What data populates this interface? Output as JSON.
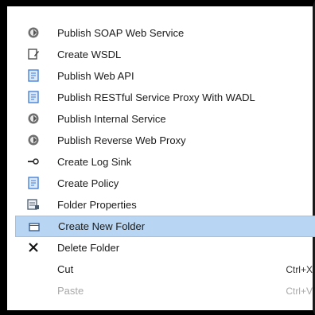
{
  "menu": {
    "items": [
      {
        "label": "Publish SOAP Web Service",
        "icon": "gear-icon"
      },
      {
        "label": "Create WSDL",
        "icon": "document-edit-icon"
      },
      {
        "label": "Publish Web API",
        "icon": "document-icon"
      },
      {
        "label": "Publish RESTful Service Proxy With WADL",
        "icon": "document-icon"
      },
      {
        "label": "Publish Internal Service",
        "icon": "gear-icon"
      },
      {
        "label": "Publish Reverse Web Proxy",
        "icon": "gear-icon"
      },
      {
        "label": "Create Log Sink",
        "icon": "key-icon"
      },
      {
        "label": "Create Policy",
        "icon": "document-icon"
      },
      {
        "label": "Folder Properties",
        "icon": "properties-icon"
      },
      {
        "label": "Create New Folder",
        "icon": "folder-icon",
        "state": "highlighted"
      },
      {
        "label": "Delete Folder",
        "icon": "close-icon"
      },
      {
        "label": "Cut",
        "shortcut": "Ctrl+X"
      },
      {
        "label": "Paste",
        "shortcut": "Ctrl+V",
        "state": "disabled"
      }
    ]
  },
  "colors": {
    "highlight": "#b8d6f3",
    "icon_blue": "#3a7bd5",
    "disabled_text": "#a9a9a9"
  }
}
